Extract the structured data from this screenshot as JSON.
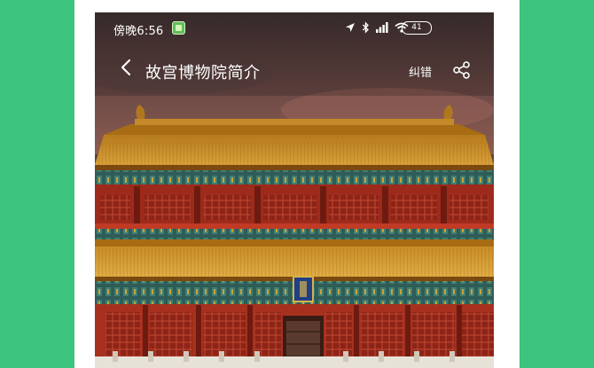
{
  "status_bar": {
    "time": "傍晚6:56",
    "battery_level": "41",
    "icons": [
      "location-arrow-icon",
      "bluetooth-icon",
      "signal-icon",
      "wifi-icon",
      "battery-icon"
    ]
  },
  "nav": {
    "back_icon": "chevron-left-icon",
    "title": "故宫博物院简介",
    "report_label": "纠错",
    "share_icon": "share-icon"
  },
  "colors": {
    "page_background": "#3dc47e",
    "card": "#ffffff",
    "roof_gold": "#c98a1e",
    "wall_red": "#a8301f"
  }
}
